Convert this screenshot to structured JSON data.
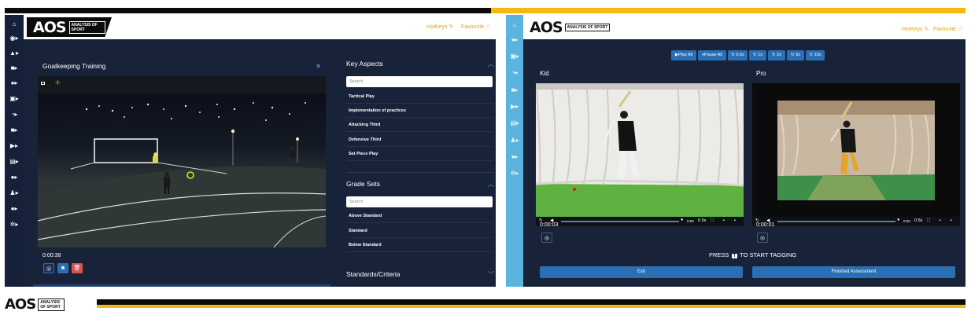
{
  "brand": {
    "logo_text": "AOS",
    "logo_subtext": "ANALYSIS OF SPORT"
  },
  "colors": {
    "navy": "#18233a",
    "accent_blue": "#2a6fb4",
    "gold": "#f6b712",
    "link_gold": "#e6a31a",
    "light_blue_rail": "#5bb4e0",
    "danger_red": "#d9534f"
  },
  "left": {
    "topbar": {
      "hotkeys": "HotKeys",
      "favourite": "Favourite ☆"
    },
    "rail_icons": [
      "home-icon",
      "user-icon",
      "graduation-icon",
      "list-icon",
      "users-icon",
      "film-icon",
      "clock-icon",
      "video-icon",
      "play-icon",
      "film-strip-icon",
      "group-icon",
      "person-icon",
      "team-icon",
      "settings-icon"
    ],
    "card": {
      "title": "Goalkeeping Training",
      "close": "×",
      "timestamp": "0:00:38"
    },
    "sections": {
      "key_aspects": {
        "title": "Key Aspects",
        "search_placeholder": "Search",
        "items": [
          "Tactical Play",
          "Implementation of practices",
          "Attacking Third",
          "Defensive Third",
          "Set Piece Play"
        ]
      },
      "grade_sets": {
        "title": "Grade Sets",
        "search_placeholder": "Search",
        "items": [
          "Above Standard",
          "Standard",
          "Below Standard"
        ]
      },
      "standards": {
        "title": "Standards/Criteria"
      }
    }
  },
  "right": {
    "topbar": {
      "hotkeys": "HotKeys",
      "favourite": "Favourite ☆"
    },
    "rail_icons": [
      "home-icon",
      "user-icon",
      "calendar-icon",
      "clock-icon",
      "video-icon",
      "play-icon",
      "film-strip-icon",
      "person-icon",
      "team-icon",
      "settings-icon"
    ],
    "controls": [
      "▶Play All",
      "⏸Pause All",
      "↻ 0.5x",
      "↻ 1x",
      "↻ 2x",
      "↻ 5x",
      "↻ 10x"
    ],
    "kid": {
      "label": "Kid",
      "time_readout": "0:00",
      "speed": "0.5x",
      "timestamp": "0:00:03"
    },
    "pro": {
      "label": "Pro",
      "time_readout": "0:00",
      "speed": "0.5x",
      "timestamp": "0:00:01"
    },
    "press_prefix": "PRESS",
    "press_key": "T",
    "press_suffix": "TO START TAGGING",
    "exit_label": "Exit",
    "finished_label": "Finished Assessment"
  }
}
